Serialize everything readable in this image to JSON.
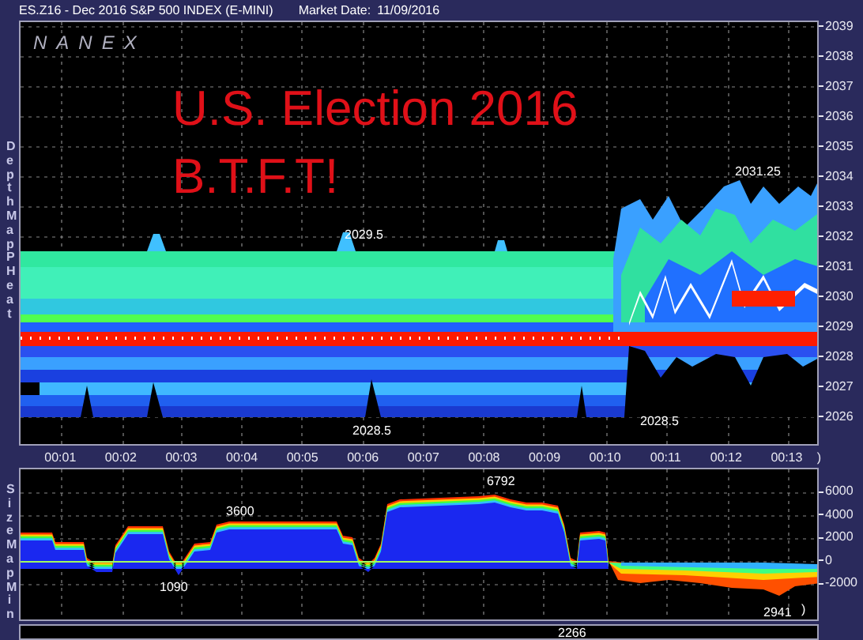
{
  "header": {
    "symbol": "ES.Z16 - Dec 2016 S&P 500 INDEX (E-MINI)",
    "market_date_label": "Market Date:",
    "market_date": "11/09/2016"
  },
  "logo": "NANEX",
  "overlay_title": [
    "U.S. Election 2016",
    "B.T.F.T!"
  ],
  "depth_chart": {
    "side_label": "Depth Map PHeat",
    "y_ticks": [
      "2039",
      "2038",
      "2037",
      "2036",
      "2035",
      "2034",
      "2033",
      "2032",
      "2031",
      "2030",
      "2029",
      "2028",
      "2027",
      "2026"
    ],
    "annotations": [
      "2029.5",
      "2031.25",
      "2028.5",
      "2028.5"
    ]
  },
  "time_axis": {
    "ticks": [
      "00:01",
      "00:02",
      "00:03",
      "00:04",
      "00:05",
      "00:06",
      "00:07",
      "00:08",
      "00:09",
      "00:10",
      "00:11",
      "00:12",
      "00:13"
    ],
    "end_mark": ")"
  },
  "size_chart": {
    "side_label": "Size Map Min",
    "y_ticks": [
      "6000",
      "4000",
      "2000",
      "0",
      "-2000"
    ],
    "annotations": [
      "3600",
      "6792",
      "1090",
      "2941"
    ],
    "end_mark": ")"
  },
  "lower_strip": {
    "annotation": "2266"
  }
}
